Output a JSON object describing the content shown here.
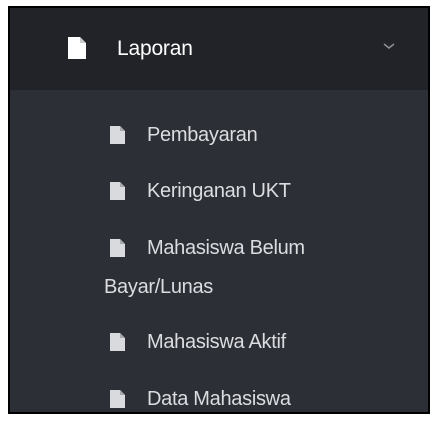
{
  "menu": {
    "header": {
      "label": "Laporan",
      "icon": "file-icon",
      "chevron_icon": "chevron-down-icon"
    },
    "items": [
      {
        "label": "Pembayaran",
        "icon": "file-icon"
      },
      {
        "label": "Keringanan UKT",
        "icon": "file-icon"
      },
      {
        "label_line1": "Mahasiswa Belum",
        "label_line2": "Bayar/Lunas",
        "icon": "file-icon"
      },
      {
        "label": "Mahasiswa Aktif",
        "icon": "file-icon"
      },
      {
        "label": "Data Mahasiswa",
        "icon": "file-icon"
      }
    ]
  },
  "colors": {
    "header_bg": "#212329",
    "submenu_bg": "#2c2f36",
    "header_text": "#ffffff",
    "item_text": "#dcdde0"
  }
}
